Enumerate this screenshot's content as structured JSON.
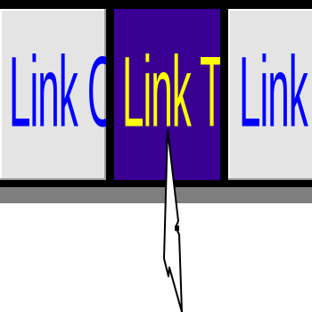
{
  "nav": {
    "tabs": [
      {
        "label": "Link One",
        "active": false
      },
      {
        "label": "Link Two",
        "active": true
      },
      {
        "label": "Link Th",
        "active": false
      }
    ]
  },
  "colors": {
    "tab_bg": "#e4e4e4",
    "tab_active_bg": "#3a0093",
    "tab_text": "#0000ff",
    "tab_active_text": "#ffff00",
    "nav_frame": "#000000",
    "nav_shadow": "#7e7e7e"
  },
  "icons": {
    "cursor": "arrow-cursor-icon"
  }
}
